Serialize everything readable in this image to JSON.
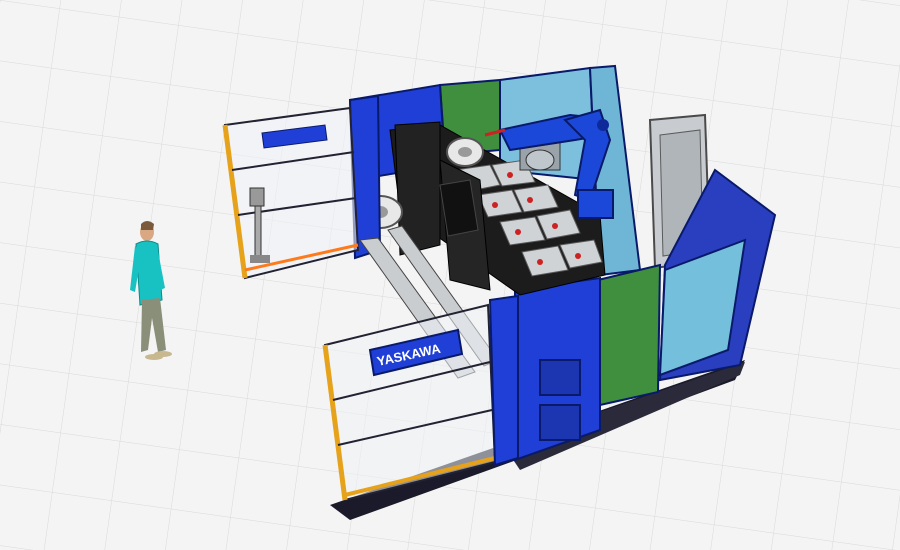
{
  "scene": {
    "brand_logo": "YASKAWA",
    "panel_logo": "YASKAWA",
    "colors": {
      "background": "#f4f4f4",
      "grid": "#d9d9d9",
      "cell_blue": "#1f3fd6",
      "fence_blue": "#2a3fbf",
      "panel_green": "#3f8f3f",
      "glass": "#6fb6d6",
      "guard_yellow": "#e6a21a",
      "floor_dark": "#1a1a2a",
      "fixture_black": "#1c1c1c",
      "robot_blue": "#1b48d8",
      "person_shirt": "#19c2c2",
      "person_pants": "#8a8f7a"
    }
  }
}
